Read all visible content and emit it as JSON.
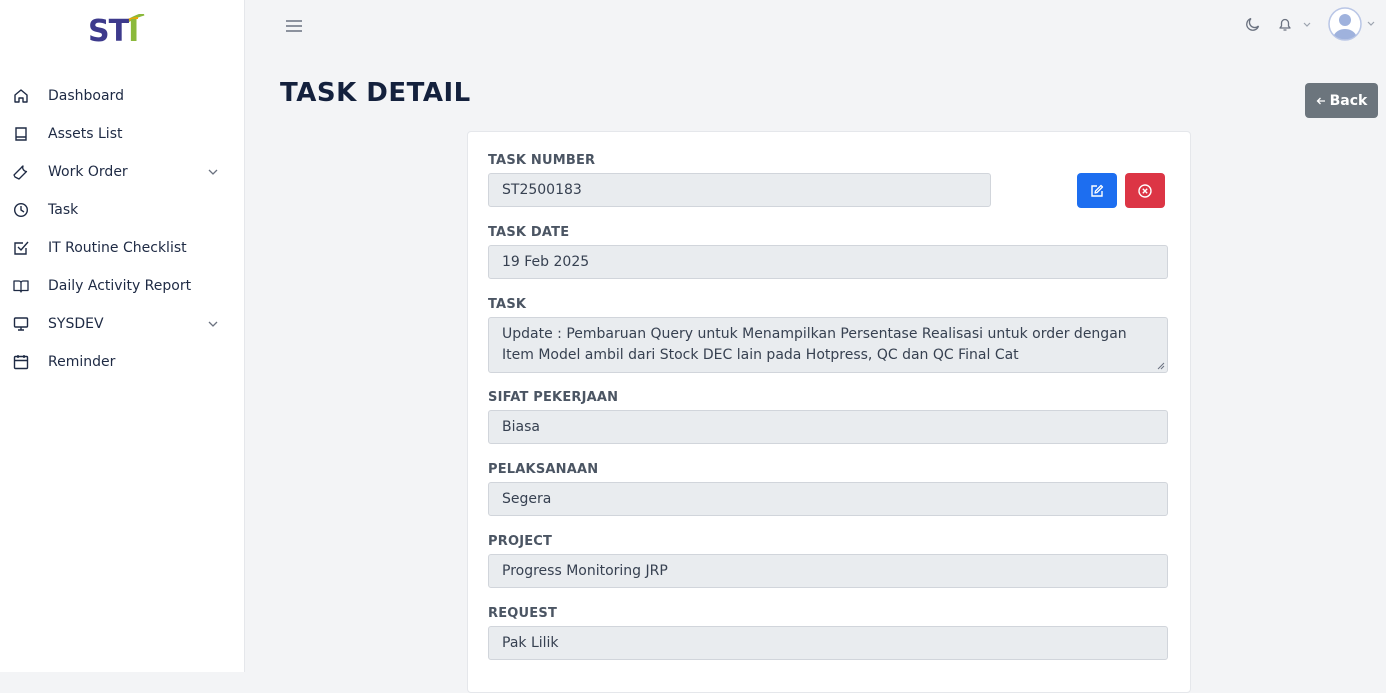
{
  "logo": {
    "s": "S",
    "t": "T",
    "i": "I"
  },
  "sidebar": {
    "items": [
      {
        "label": "Dashboard",
        "icon": "home-icon"
      },
      {
        "label": "Assets List",
        "icon": "book-icon"
      },
      {
        "label": "Work Order",
        "icon": "wrench-icon",
        "expandable": true
      },
      {
        "label": "Task",
        "icon": "clock-icon"
      },
      {
        "label": "IT Routine Checklist",
        "icon": "check-square-icon"
      },
      {
        "label": "Daily Activity Report",
        "icon": "book-open-icon"
      },
      {
        "label": "SYSDEV",
        "icon": "monitor-icon",
        "expandable": true
      },
      {
        "label": "Reminder",
        "icon": "calendar-icon"
      }
    ]
  },
  "page": {
    "title": "TASK DETAIL",
    "back_label": "Back"
  },
  "fields": {
    "task_number": {
      "label": "TASK NUMBER",
      "value": "ST2500183"
    },
    "task_date": {
      "label": "TASK DATE",
      "value": "19 Feb 2025"
    },
    "task": {
      "label": "TASK",
      "value": "Update : Pembaruan Query untuk Menampilkan Persentase Realisasi untuk order dengan Item Model ambil dari Stock DEC lain pada Hotpress, QC dan QC Final Cat"
    },
    "sifat_pekerjaan": {
      "label": "SIFAT PEKERJAAN",
      "value": "Biasa"
    },
    "pelaksanaan": {
      "label": "PELAKSANAAN",
      "value": "Segera"
    },
    "project": {
      "label": "PROJECT",
      "value": "Progress Monitoring JRP"
    },
    "request": {
      "label": "REQUEST",
      "value": "Pak Lilik"
    }
  },
  "colors": {
    "edit_button": "#1d6ef0",
    "delete_button": "#dc3545",
    "back_button": "#6c757d",
    "title": "#14213d"
  }
}
